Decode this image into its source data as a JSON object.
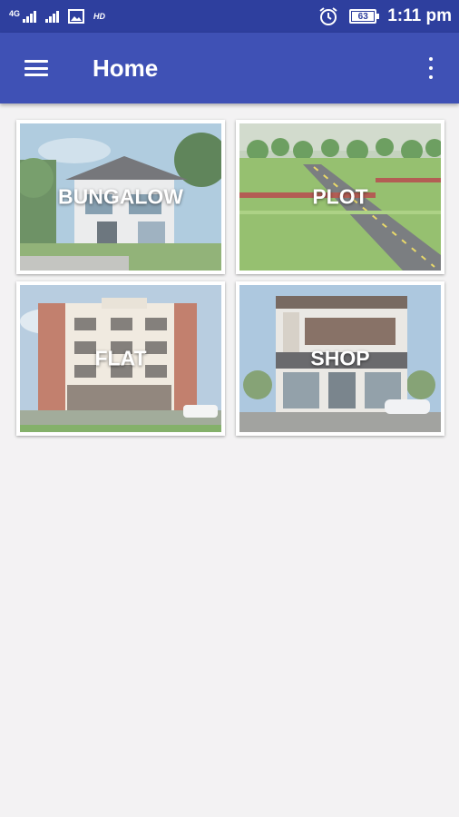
{
  "status_bar": {
    "network_label": "4G",
    "hd_label": "HD",
    "battery_level": "63",
    "time": "1:11 pm",
    "icons": [
      "signal-icon",
      "signal-icon",
      "image-icon",
      "alarm-icon",
      "battery-icon"
    ]
  },
  "app_bar": {
    "title": "Home",
    "menu_icon": "hamburger-menu-icon",
    "overflow_icon": "more-vert-icon",
    "color": "#3f51b5",
    "status_color": "#2e3f9e"
  },
  "categories": [
    {
      "label": "BUNGALOW"
    },
    {
      "label": "PLOT"
    },
    {
      "label": "FLAT"
    },
    {
      "label": "SHOP"
    }
  ]
}
